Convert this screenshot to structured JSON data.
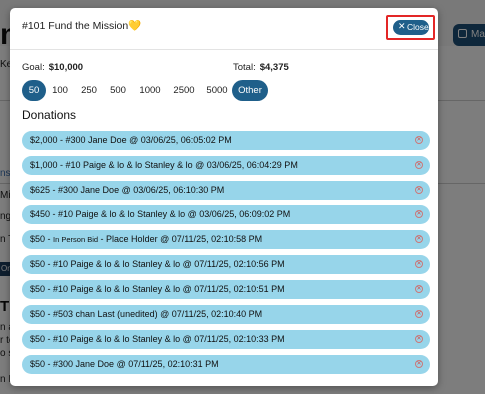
{
  "background": {
    "title": "m",
    "lines": [
      "Keyw",
      "ns",
      "Mis",
      "nge",
      "n T",
      "Only",
      "THI",
      "n ab",
      "r to",
      "o s",
      "n Ite"
    ],
    "header_button": "Ma"
  },
  "modal": {
    "title": "#101 Fund the Mission💛",
    "close_label": "Close",
    "goal_label": "Goal:",
    "goal_value": "$10,000",
    "total_label": "Total:",
    "total_value": "$4,375",
    "amounts": [
      {
        "label": "50",
        "selected": true
      },
      {
        "label": "100",
        "selected": false
      },
      {
        "label": "250",
        "selected": false
      },
      {
        "label": "500",
        "selected": false
      },
      {
        "label": "1000",
        "selected": false
      },
      {
        "label": "2500",
        "selected": false
      },
      {
        "label": "5000",
        "selected": false
      },
      {
        "label": "Other",
        "selected": true
      }
    ],
    "donations_heading": "Donations",
    "donations": [
      {
        "text": "$2,000 - #300 Jane Doe @ 03/06/25, 06:05:02 PM"
      },
      {
        "text": "$1,000 - #10 Paige & lo & lo Stanley & lo @ 03/06/25, 06:04:29 PM"
      },
      {
        "text": "$625 - #300 Jane Doe @ 03/06/25, 06:10:30 PM"
      },
      {
        "text": "$450 - #10 Paige & lo & lo Stanley & lo @ 03/06/25, 06:09:02 PM"
      },
      {
        "text_a": "$50 - ",
        "bid": "In Person Bid",
        "text_b": " - Place Holder @ 07/11/25, 02:10:58 PM"
      },
      {
        "text": "$50 - #10 Paige & lo & lo Stanley & lo @ 07/11/25, 02:10:56 PM"
      },
      {
        "text": "$50 - #10 Paige & lo & lo Stanley & lo @ 07/11/25, 02:10:51 PM"
      },
      {
        "text": "$50 - #503 chan Last (unedited) @ 07/11/25, 02:10:40 PM"
      },
      {
        "text": "$50 - #10 Paige & lo & lo Stanley & lo @ 07/11/25, 02:10:33 PM"
      },
      {
        "text": "$50 - #300 Jane Doe @ 07/11/25, 02:10:31 PM"
      }
    ]
  },
  "colors": {
    "accent": "#1f5f8a",
    "donation_row": "#97d5ea",
    "close_highlight": "#e32626"
  }
}
